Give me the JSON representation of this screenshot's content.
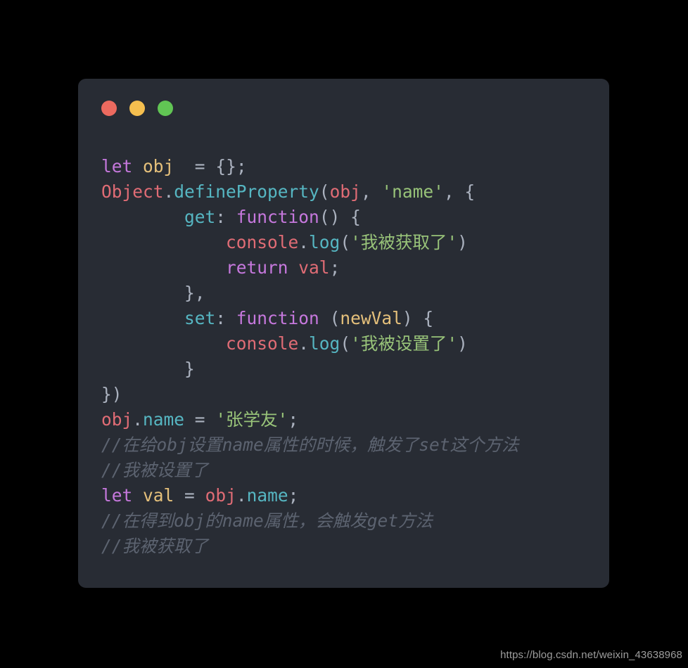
{
  "window_controls": {
    "close_label": "close",
    "minimize_label": "minimize",
    "maximize_label": "maximize",
    "close_color": "#ec6a5f",
    "minimize_color": "#f5bf4f",
    "maximize_color": "#61c554"
  },
  "theme": {
    "page_background": "#000000",
    "card_background": "#282c34",
    "keyword": "#c678dd",
    "variable": "#e5c07b",
    "object": "#e06c75",
    "property": "#56b6c2",
    "string": "#98c379",
    "punctuation": "#abb2bf",
    "comment": "#5c6370"
  },
  "code": {
    "language": "javascript",
    "lines": [
      {
        "n": 1,
        "text": "let obj  = {};",
        "tokens": [
          {
            "t": "let",
            "c": "t-kw"
          },
          {
            "t": " ",
            "c": "t-plain"
          },
          {
            "t": "obj",
            "c": "t-var"
          },
          {
            "t": "  = ",
            "c": "t-punc"
          },
          {
            "t": "{};",
            "c": "t-punc"
          }
        ]
      },
      {
        "n": 2,
        "text": "Object.defineProperty(obj, 'name', {",
        "tokens": [
          {
            "t": "Object",
            "c": "t-obj"
          },
          {
            "t": ".",
            "c": "t-punc"
          },
          {
            "t": "defineProperty",
            "c": "t-prop"
          },
          {
            "t": "(",
            "c": "t-punc"
          },
          {
            "t": "obj",
            "c": "t-obj"
          },
          {
            "t": ", ",
            "c": "t-punc"
          },
          {
            "t": "'name'",
            "c": "t-str"
          },
          {
            "t": ", {",
            "c": "t-punc"
          }
        ]
      },
      {
        "n": 3,
        "text": "        get: function() {",
        "tokens": [
          {
            "t": "        ",
            "c": "t-plain"
          },
          {
            "t": "get",
            "c": "t-prop"
          },
          {
            "t": ": ",
            "c": "t-punc"
          },
          {
            "t": "function",
            "c": "t-kw"
          },
          {
            "t": "() {",
            "c": "t-punc"
          }
        ]
      },
      {
        "n": 4,
        "text": "            console.log('我被获取了')",
        "tokens": [
          {
            "t": "            ",
            "c": "t-plain"
          },
          {
            "t": "console",
            "c": "t-obj"
          },
          {
            "t": ".",
            "c": "t-punc"
          },
          {
            "t": "log",
            "c": "t-prop"
          },
          {
            "t": "(",
            "c": "t-punc"
          },
          {
            "t": "'我被获取了'",
            "c": "t-str"
          },
          {
            "t": ")",
            "c": "t-punc"
          }
        ]
      },
      {
        "n": 5,
        "text": "            return val;",
        "tokens": [
          {
            "t": "            ",
            "c": "t-plain"
          },
          {
            "t": "return",
            "c": "t-kw"
          },
          {
            "t": " ",
            "c": "t-plain"
          },
          {
            "t": "val",
            "c": "t-obj"
          },
          {
            "t": ";",
            "c": "t-punc"
          }
        ]
      },
      {
        "n": 6,
        "text": "        },",
        "tokens": [
          {
            "t": "        },",
            "c": "t-punc"
          }
        ]
      },
      {
        "n": 7,
        "text": "        set: function (newVal) {",
        "tokens": [
          {
            "t": "        ",
            "c": "t-plain"
          },
          {
            "t": "set",
            "c": "t-prop"
          },
          {
            "t": ": ",
            "c": "t-punc"
          },
          {
            "t": "function",
            "c": "t-kw"
          },
          {
            "t": " (",
            "c": "t-punc"
          },
          {
            "t": "newVal",
            "c": "t-var"
          },
          {
            "t": ") {",
            "c": "t-punc"
          }
        ]
      },
      {
        "n": 8,
        "text": "            console.log('我被设置了')",
        "tokens": [
          {
            "t": "            ",
            "c": "t-plain"
          },
          {
            "t": "console",
            "c": "t-obj"
          },
          {
            "t": ".",
            "c": "t-punc"
          },
          {
            "t": "log",
            "c": "t-prop"
          },
          {
            "t": "(",
            "c": "t-punc"
          },
          {
            "t": "'我被设置了'",
            "c": "t-str"
          },
          {
            "t": ")",
            "c": "t-punc"
          }
        ]
      },
      {
        "n": 9,
        "text": "        }",
        "tokens": [
          {
            "t": "        }",
            "c": "t-punc"
          }
        ]
      },
      {
        "n": 10,
        "text": "})",
        "tokens": [
          {
            "t": "})",
            "c": "t-punc"
          }
        ]
      },
      {
        "n": 11,
        "text": "obj.name = '张学友';",
        "tokens": [
          {
            "t": "obj",
            "c": "t-obj"
          },
          {
            "t": ".",
            "c": "t-punc"
          },
          {
            "t": "name",
            "c": "t-prop"
          },
          {
            "t": " = ",
            "c": "t-punc"
          },
          {
            "t": "'张学友'",
            "c": "t-str"
          },
          {
            "t": ";",
            "c": "t-punc"
          }
        ]
      },
      {
        "n": 12,
        "text": "//在给obj设置name属性的时候，触发了set这个方法",
        "tokens": [
          {
            "t": "//在给obj设置name属性的时候，触发了set这个方法",
            "c": "t-comment"
          }
        ]
      },
      {
        "n": 13,
        "text": "//我被设置了",
        "tokens": [
          {
            "t": "//我被设置了",
            "c": "t-comment"
          }
        ]
      },
      {
        "n": 14,
        "text": "let val = obj.name;",
        "tokens": [
          {
            "t": "let",
            "c": "t-kw"
          },
          {
            "t": " ",
            "c": "t-plain"
          },
          {
            "t": "val",
            "c": "t-var"
          },
          {
            "t": " = ",
            "c": "t-punc"
          },
          {
            "t": "obj",
            "c": "t-obj"
          },
          {
            "t": ".",
            "c": "t-punc"
          },
          {
            "t": "name",
            "c": "t-prop"
          },
          {
            "t": ";",
            "c": "t-punc"
          }
        ]
      },
      {
        "n": 15,
        "text": "//在得到obj的name属性，会触发get方法",
        "tokens": [
          {
            "t": "//在得到obj的name属性，会触发get方法",
            "c": "t-comment"
          }
        ]
      },
      {
        "n": 16,
        "text": "//我被获取了",
        "tokens": [
          {
            "t": "//我被获取了",
            "c": "t-comment"
          }
        ]
      }
    ]
  },
  "watermark": {
    "text": "https://blog.csdn.net/weixin_43638968"
  }
}
